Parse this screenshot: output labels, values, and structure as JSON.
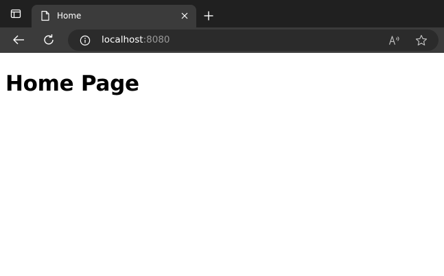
{
  "browser": {
    "tab": {
      "title": "Home"
    },
    "address_bar": {
      "host": "localhost",
      "port": ":8080"
    }
  },
  "page": {
    "heading": "Home Page"
  },
  "icons": {
    "tab_actions": "tab-actions-icon",
    "favicon": "page-icon",
    "close": "close-icon",
    "new_tab": "plus-icon",
    "back": "back-arrow-icon",
    "refresh": "refresh-icon",
    "info": "info-icon",
    "read_aloud": "read-aloud-icon",
    "favorites": "star-icon"
  },
  "colors": {
    "tabbar_bg": "#202020",
    "active_tab_bg": "#3b3b3b",
    "omnibox_bg": "#2b2b2b",
    "port_text": "#9a9a9a"
  }
}
